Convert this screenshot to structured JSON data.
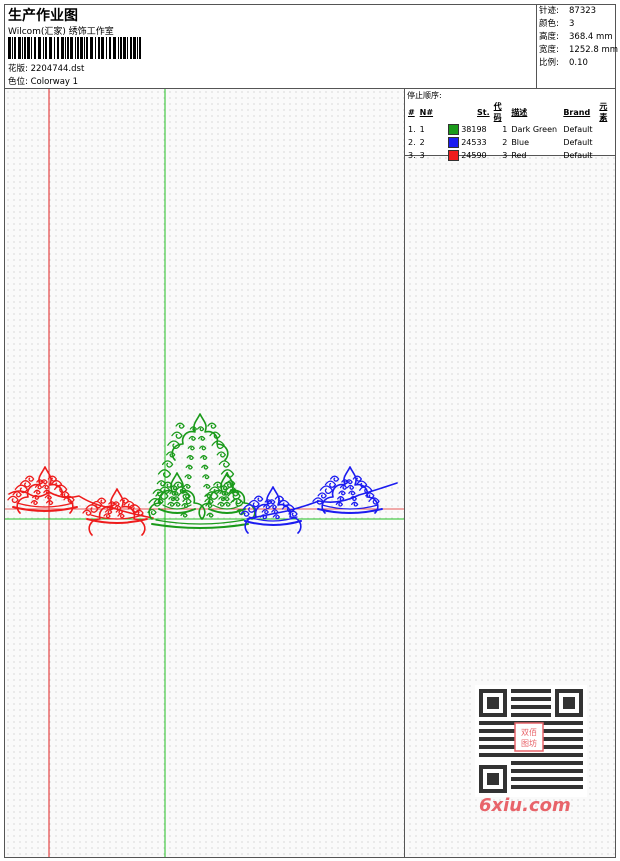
{
  "header": {
    "title": "生产作业图",
    "subtitle": "Wilcom(汇家) 绣饰工作室",
    "design_label": "花版:",
    "design_value": "2204744.dst",
    "colorway_label": "色位:",
    "colorway_value": "Colorway 1"
  },
  "stats": [
    {
      "label": "针迹:",
      "value": "87323"
    },
    {
      "label": "颜色:",
      "value": "3"
    },
    {
      "label": "高度:",
      "value": "368.4 mm"
    },
    {
      "label": "宽度:",
      "value": "1252.8 mm"
    },
    {
      "label": "比例:",
      "value": "0.10"
    }
  ],
  "stop_sequence": {
    "title": "停止顺序:",
    "columns": [
      "#",
      "N#",
      "St.",
      "代码",
      "描述",
      "Brand",
      "元素"
    ],
    "rows": [
      {
        "num": "1.",
        "n": "1",
        "color": "#1a9a1a",
        "stitches": "38198",
        "code": "1",
        "desc": "Dark Green",
        "brand": "Default"
      },
      {
        "num": "2.",
        "n": "2",
        "color": "#1c1cf0",
        "stitches": "24533",
        "code": "2",
        "desc": "Blue",
        "brand": "Default"
      },
      {
        "num": "3.",
        "n": "3",
        "color": "#ee1c1c",
        "stitches": "24590",
        "code": "3",
        "desc": "Red",
        "brand": "Default"
      }
    ]
  },
  "colors": {
    "red": "#ee1c1c",
    "green": "#1a9a1a",
    "blue": "#1c1cf0",
    "crosshair_red": "#e02020",
    "crosshair_green": "#20c020"
  },
  "watermark": {
    "text": "6xiu.com",
    "seal": "双佰图坊"
  }
}
